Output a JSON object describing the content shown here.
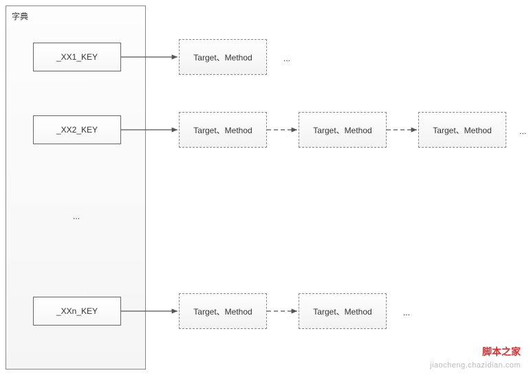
{
  "dict": {
    "title": "字典",
    "keys": [
      "_XX1_KEY",
      "_XX2_KEY",
      "_XXn_KEY"
    ],
    "vertical_ellipsis": "..."
  },
  "target_label": "Target、Method",
  "rows": [
    {
      "key_index": 0,
      "targets": 1,
      "trailing_ellipsis": true
    },
    {
      "key_index": 1,
      "targets": 3,
      "trailing_ellipsis": true
    },
    {
      "key_index": 2,
      "targets": 2,
      "trailing_ellipsis": true
    }
  ],
  "watermark": {
    "line1": "脚本之家",
    "line2": "jiaocheng.chazidian.com"
  }
}
